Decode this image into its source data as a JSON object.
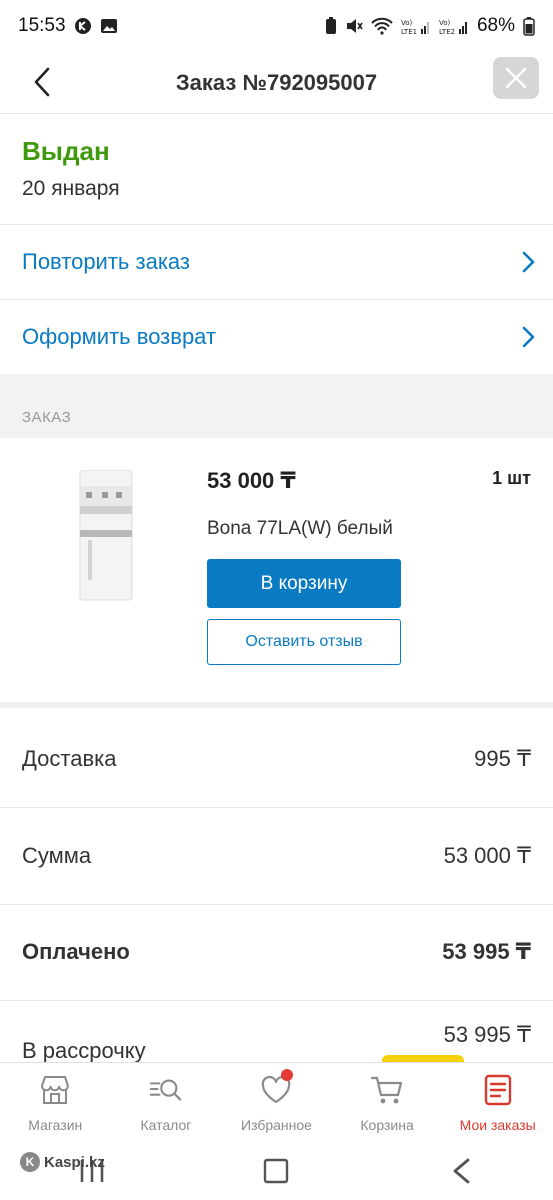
{
  "status_bar": {
    "time": "15:53",
    "battery": "68%"
  },
  "header": {
    "title": "Заказ №792095007"
  },
  "order_status": {
    "title": "Выдан",
    "date": "20 января"
  },
  "actions": [
    {
      "label": "Повторить заказ"
    },
    {
      "label": "Оформить возврат"
    }
  ],
  "section": {
    "label": "ЗАКАЗ"
  },
  "product": {
    "price": "53 000 ₸",
    "quantity": "1 шт",
    "name": "Bona 77LA(W) белый",
    "cart_button": "В корзину",
    "review_button": "Оставить отзыв"
  },
  "summary": [
    {
      "label": "Доставка",
      "value": "995 ₸"
    },
    {
      "label": "Сумма",
      "value": "53 000 ₸"
    },
    {
      "label": "Оплачено",
      "value": "53 995 ₸"
    }
  ],
  "installment": {
    "label": "В рассрочку",
    "value": "53 995 ₸"
  },
  "tabs": [
    {
      "label": "Магазин",
      "icon": "shop-icon"
    },
    {
      "label": "Каталог",
      "icon": "catalog-search-icon"
    },
    {
      "label": "Избранное",
      "icon": "heart-icon"
    },
    {
      "label": "Корзина",
      "icon": "cart-icon"
    },
    {
      "label": "Мои заказы",
      "icon": "orders-icon"
    }
  ],
  "watermark": {
    "text": "Kaspi.kz"
  },
  "colors": {
    "accent": "#0a7bc2",
    "status_green": "#3e9a0c",
    "active_tab": "#d93a2e",
    "badge_yellow": "#f5d10a"
  }
}
